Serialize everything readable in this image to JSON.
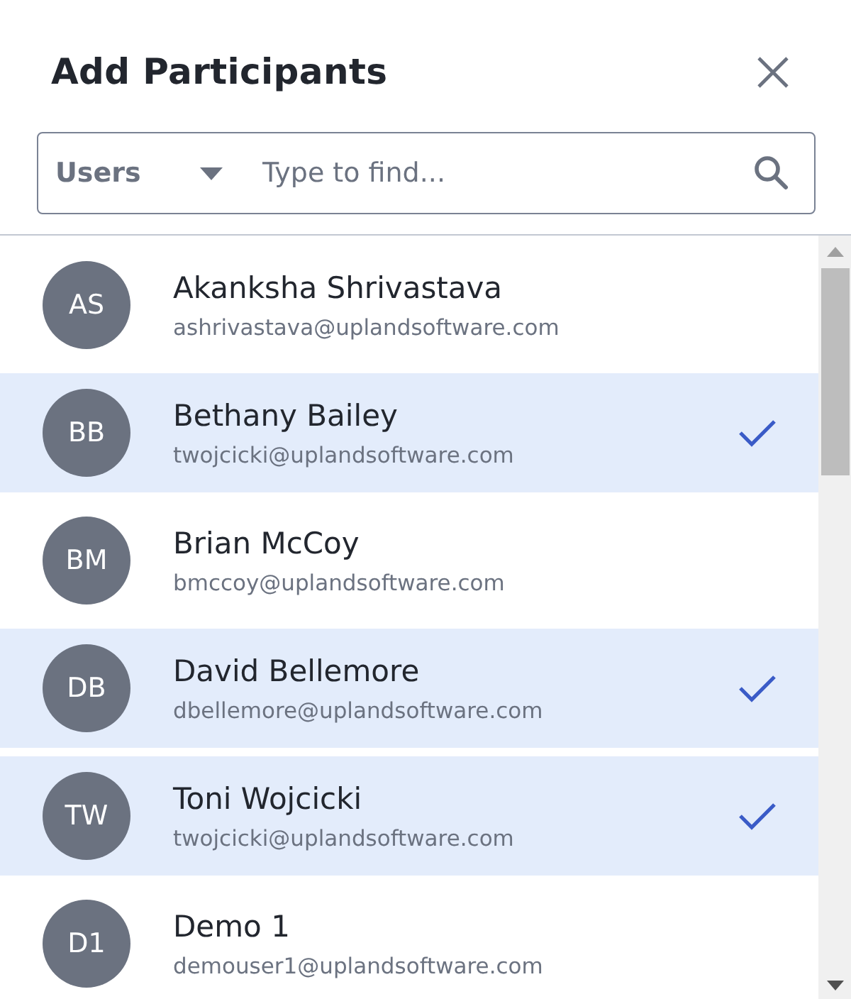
{
  "dialog": {
    "title": "Add Participants"
  },
  "search": {
    "filter": "Users",
    "placeholder": "Type to find..."
  },
  "participants": [
    {
      "initials": "AS",
      "name": "Akanksha Shrivastava",
      "email": "ashrivastava@uplandsoftware.com",
      "selected": false
    },
    {
      "initials": "BB",
      "name": "Bethany Bailey",
      "email": "twojcicki@uplandsoftware.com",
      "selected": true
    },
    {
      "initials": "BM",
      "name": "Brian McCoy",
      "email": "bmccoy@uplandsoftware.com",
      "selected": false
    },
    {
      "initials": "DB",
      "name": "David Bellemore",
      "email": "dbellemore@uplandsoftware.com",
      "selected": true
    },
    {
      "initials": "TW",
      "name": "Toni Wojcicki",
      "email": "twojcicki@uplandsoftware.com",
      "selected": true
    },
    {
      "initials": "D1",
      "name": "Demo 1",
      "email": "demouser1@uplandsoftware.com",
      "selected": false
    }
  ]
}
